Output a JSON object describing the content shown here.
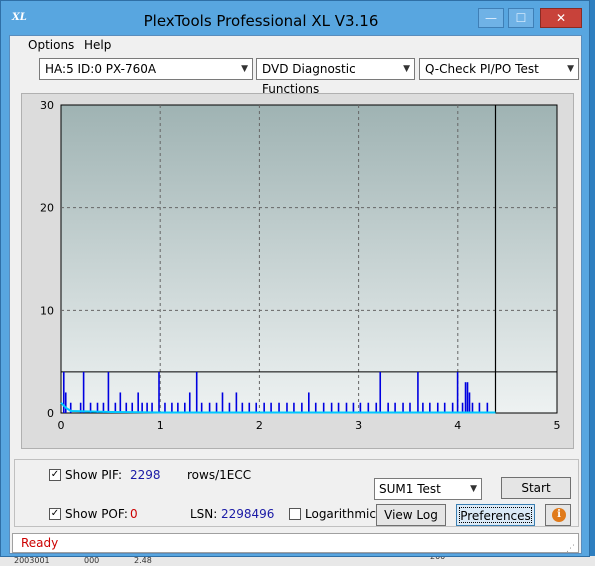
{
  "window": {
    "title": "PlexTools Professional XL V3.16",
    "icon": "XL",
    "controls": {
      "minimize": "—",
      "maximize": "☐",
      "close": "✕"
    }
  },
  "menu": {
    "options": "Options",
    "help": "Help"
  },
  "toolbar": {
    "drive": "HA:5 ID:0  PX-760A",
    "function": "DVD Diagnostic Functions",
    "test": "Q-Check PI/PO Test"
  },
  "colors": {
    "pif": "#0000e0",
    "poi": "#00c8ff",
    "plot_bg_top": "#9fb3b3",
    "plot_bg_bottom": "#eef2f2"
  },
  "chart_data": {
    "type": "bar",
    "xlim": [
      0,
      5
    ],
    "ylim": [
      0,
      30
    ],
    "x_ticks": [
      "0",
      "1",
      "2",
      "3",
      "4",
      "5"
    ],
    "y_ticks": [
      "0",
      "10",
      "20",
      "30"
    ],
    "grid": true,
    "end_marker_x": 4.38,
    "limit_line_y": 4,
    "series": [
      {
        "values": [
          [
            0.03,
            4
          ],
          [
            0.05,
            2
          ],
          [
            0.1,
            1
          ],
          [
            0.2,
            1
          ],
          [
            0.23,
            4
          ],
          [
            0.3,
            1
          ],
          [
            0.37,
            1
          ],
          [
            0.43,
            1
          ],
          [
            0.48,
            4
          ],
          [
            0.55,
            1
          ],
          [
            0.6,
            2
          ],
          [
            0.66,
            1
          ],
          [
            0.72,
            1
          ],
          [
            0.78,
            2
          ],
          [
            0.82,
            1
          ],
          [
            0.87,
            1
          ],
          [
            0.92,
            1
          ],
          [
            0.99,
            4
          ],
          [
            1.05,
            1
          ],
          [
            1.12,
            1
          ],
          [
            1.18,
            1
          ],
          [
            1.25,
            1
          ],
          [
            1.3,
            2
          ],
          [
            1.37,
            4
          ],
          [
            1.42,
            1
          ],
          [
            1.5,
            1
          ],
          [
            1.57,
            1
          ],
          [
            1.63,
            2
          ],
          [
            1.7,
            1
          ],
          [
            1.77,
            2
          ],
          [
            1.83,
            1
          ],
          [
            1.9,
            1
          ],
          [
            1.97,
            1
          ],
          [
            2.05,
            1
          ],
          [
            2.12,
            1
          ],
          [
            2.2,
            1
          ],
          [
            2.28,
            1
          ],
          [
            2.35,
            1
          ],
          [
            2.43,
            1
          ],
          [
            2.5,
            2
          ],
          [
            2.57,
            1
          ],
          [
            2.65,
            1
          ],
          [
            2.73,
            1
          ],
          [
            2.8,
            1
          ],
          [
            2.88,
            1
          ],
          [
            2.95,
            1
          ],
          [
            3.02,
            1
          ],
          [
            3.1,
            1
          ],
          [
            3.18,
            1
          ],
          [
            3.22,
            4
          ],
          [
            3.3,
            1
          ],
          [
            3.37,
            1
          ],
          [
            3.45,
            1
          ],
          [
            3.52,
            1
          ],
          [
            3.6,
            4
          ],
          [
            3.65,
            1
          ],
          [
            3.72,
            1
          ],
          [
            3.8,
            1
          ],
          [
            3.87,
            1
          ],
          [
            3.95,
            1
          ],
          [
            4.0,
            4
          ],
          [
            4.05,
            1
          ],
          [
            4.08,
            3
          ],
          [
            4.1,
            3
          ],
          [
            4.12,
            2
          ],
          [
            4.15,
            1
          ],
          [
            4.22,
            1
          ],
          [
            4.3,
            1
          ]
        ]
      },
      {
        "values": [
          [
            0.0,
            1
          ],
          [
            0.02,
            0.8
          ],
          [
            0.05,
            0.5
          ],
          [
            0.1,
            0.2
          ],
          [
            0.5,
            0.1
          ],
          [
            1.0,
            0.05
          ],
          [
            2.0,
            0.05
          ],
          [
            3.0,
            0.05
          ],
          [
            4.0,
            0.05
          ],
          [
            4.38,
            0.05
          ]
        ]
      }
    ]
  },
  "controls": {
    "show_pif_label": "Show PIF:",
    "pif_value": "2298",
    "pif_unit": "rows/1ECC",
    "show_pof_label": "Show POF:",
    "pof_value": "0",
    "lsn_label": "LSN:",
    "lsn_value": "2298496",
    "logarithmic_label": "Logarithmic",
    "sum_test": "SUM1 Test",
    "start": "Start",
    "view_log": "View Log",
    "preferences": "Preferences",
    "pif_checked": "✓",
    "pof_checked": "✓"
  },
  "status": {
    "text": "Ready"
  },
  "background_text": [
    "2003001",
    "000",
    "2.48",
    "200"
  ]
}
